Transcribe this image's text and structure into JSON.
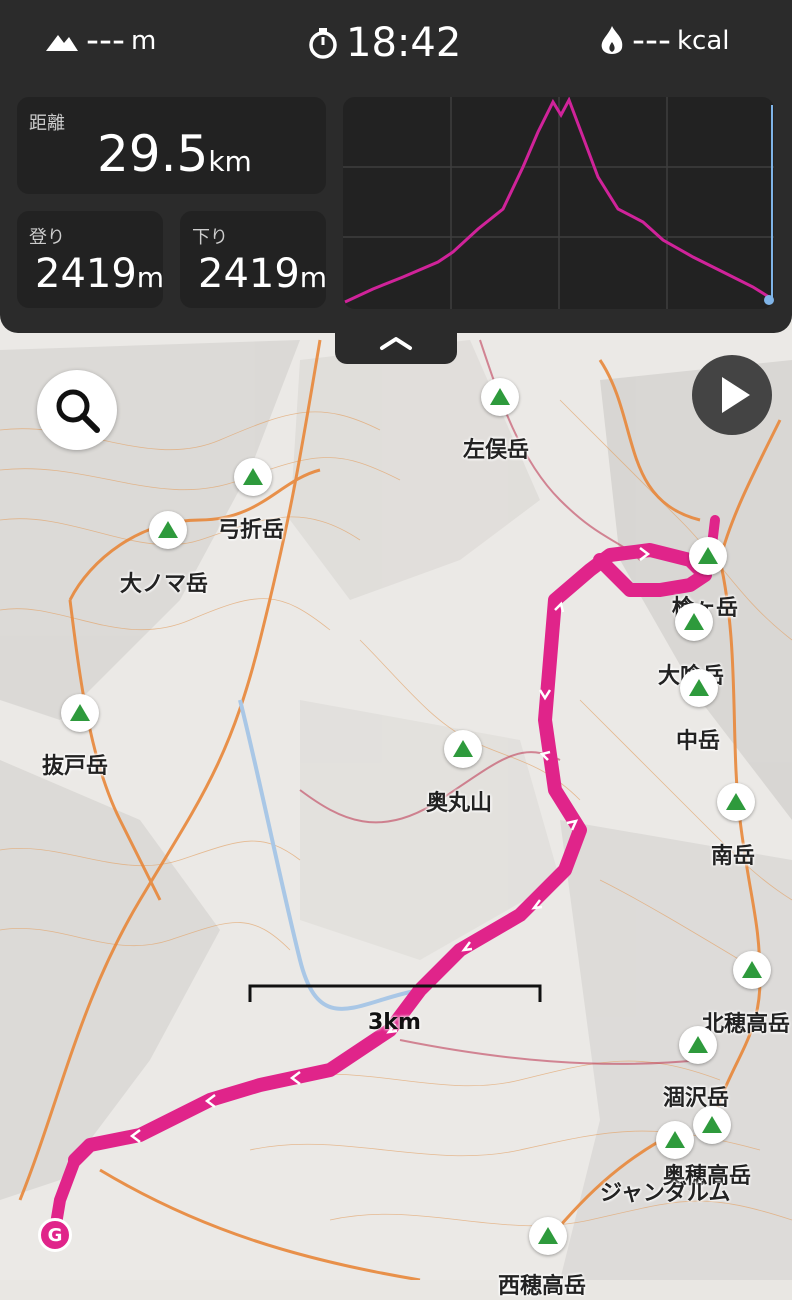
{
  "header": {
    "elevation_value": "---",
    "elevation_unit": "m",
    "time": "18:42",
    "calories_value": "---",
    "calories_unit": "kcal"
  },
  "stats": {
    "distance_label": "距離",
    "distance_value": "29.5",
    "distance_unit": "km",
    "ascent_label": "登り",
    "ascent_value": "2419",
    "ascent_unit": "m",
    "descent_label": "下り",
    "descent_value": "2419",
    "descent_unit": "m"
  },
  "colors": {
    "route": "#e0248a",
    "panel": "#2b2b2b",
    "card": "#222222",
    "peak_icon": "#2e9a3c",
    "trail": "#e8873a"
  },
  "map": {
    "scale_label": "3km",
    "goal_marker": "G",
    "peaks": [
      "左俣岳",
      "弓折岳",
      "大ノマ岳",
      "抜戸岳",
      "槍ヶ岳",
      "大喰岳",
      "中岳",
      "奥丸山",
      "南岳",
      "北穂高岳",
      "涸沢岳",
      "奥穂高岳",
      "ジャンダルム",
      "西穂高岳"
    ]
  },
  "icons": {
    "elevation": "mountain-icon",
    "time": "stopwatch-icon",
    "calories": "flame-icon",
    "search": "search-icon",
    "play": "play-icon",
    "collapse": "chevron-up-icon"
  }
}
